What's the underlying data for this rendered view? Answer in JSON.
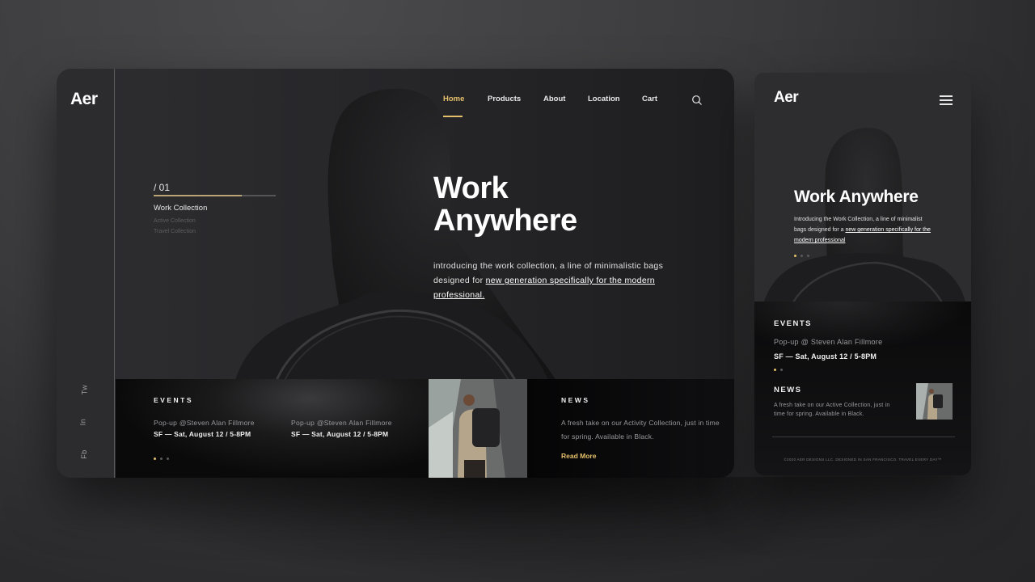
{
  "brand": "Aer",
  "colors": {
    "accent": "#e5c06a",
    "background": "#3a3a3c",
    "panel": "#262629",
    "dark": "#0d0d0e"
  },
  "desktop": {
    "nav": [
      {
        "label": "Home",
        "active": true
      },
      {
        "label": "Products",
        "active": false
      },
      {
        "label": "About",
        "active": false
      },
      {
        "label": "Location",
        "active": false
      },
      {
        "label": "Cart",
        "active": false
      }
    ],
    "search_icon": "search-icon",
    "social": [
      "Tw",
      "In",
      "Fb"
    ],
    "slider": {
      "index": "/ 01",
      "progress_percent": 72,
      "collections": [
        "Work Collection",
        "Active Collection",
        "Travel Collection"
      ]
    },
    "hero": {
      "title_line1": "Work",
      "title_line2": "Anywhere",
      "text_plain": "introducing the work collection, a line of minimalistic bags designed for ",
      "text_link": "new generation specifically for the modern professional."
    },
    "events": {
      "title": "EVENTS",
      "items": [
        {
          "name": "Pop-up @Steven Alan Fillmore",
          "date": "SF — Sat, August 12 / 5-8PM"
        },
        {
          "name": "Pop-up @Steven Alan Fillmore",
          "date": "SF — Sat, August 12 / 5-8PM"
        }
      ],
      "pagination": {
        "total": 3,
        "active": 1
      }
    },
    "news": {
      "title": "NEWS",
      "text": "A fresh take on our Activity Collection, just in time for spring. Available in Black.",
      "link": "Read More"
    }
  },
  "mobile": {
    "menu_icon": "hamburger-menu-icon",
    "hero": {
      "title": "Work Anywhere",
      "text_plain": "Introducing the Work Collection, a line of minimalist bags designed for a ",
      "text_link": "new generation specifically for the modern professional",
      "pagination": {
        "total": 3,
        "active": 1
      }
    },
    "events": {
      "title": "EVENTS",
      "name": "Pop-up @ Steven Alan Fillmore",
      "date": "SF — Sat, August 12 / 5-8PM",
      "pagination": {
        "total": 2,
        "active": 1
      }
    },
    "news": {
      "title": "NEWS",
      "text": "A fresh take on our Active Collection, just in time for spring. Available in Black."
    },
    "footer": "©2020 AER DESIGNS LLC. DESIGNED IN SAN FRANCISCO. TRAVEL EVERY DAY™"
  }
}
